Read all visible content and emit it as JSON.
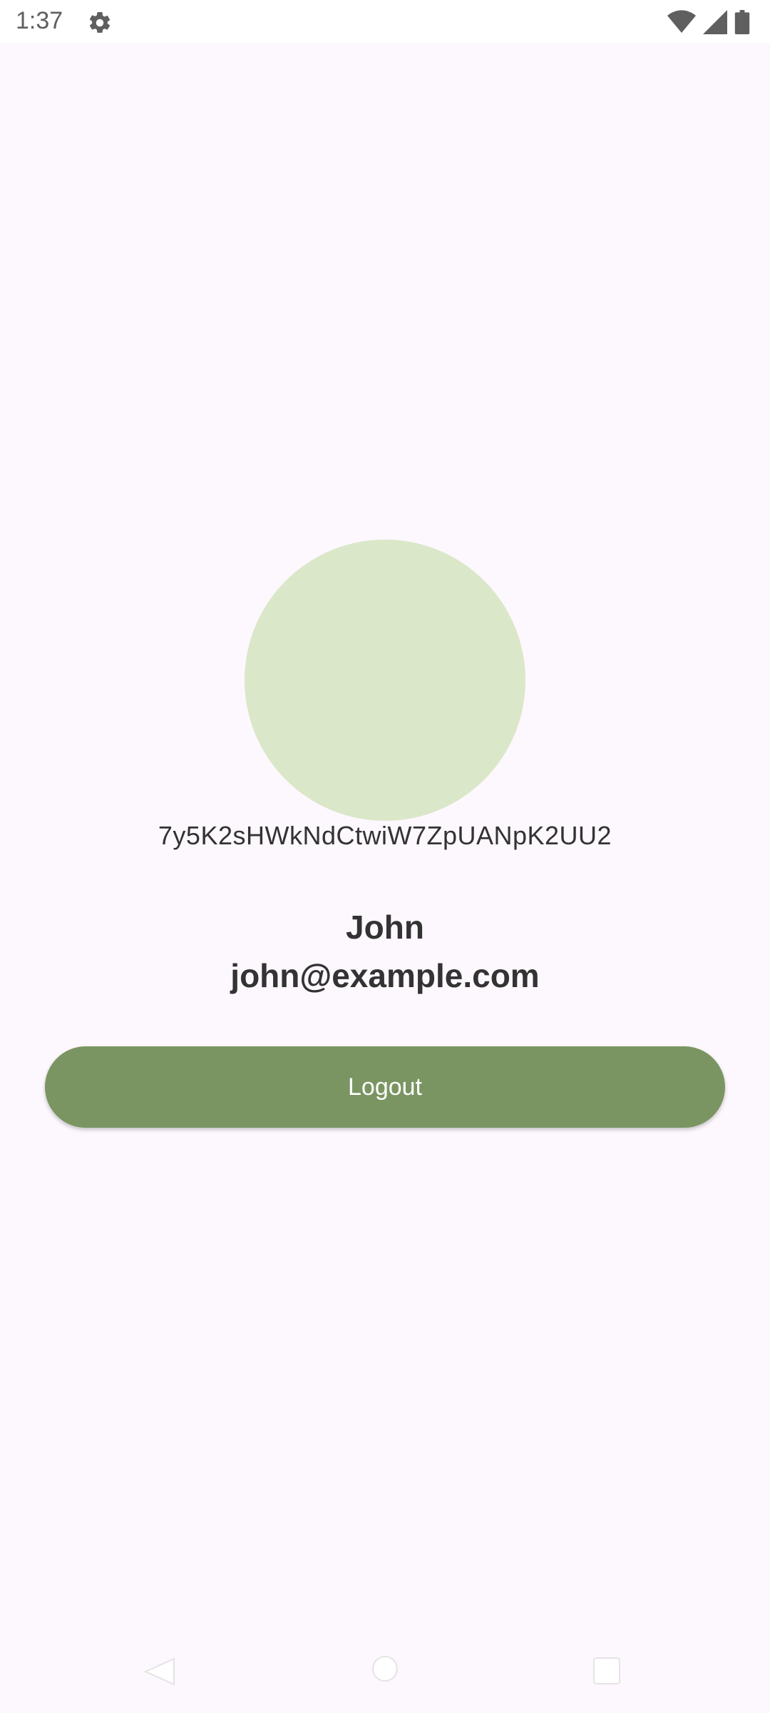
{
  "status_bar": {
    "time": "1:37",
    "icons": [
      "gear-icon",
      "wifi-icon",
      "signal-icon",
      "battery-icon"
    ]
  },
  "profile": {
    "uid": "7y5K2sHWkNdCtwiW7ZpUANpK2UU2",
    "name": "John",
    "email": "john@example.com",
    "avatar_color": "#dae7c9"
  },
  "actions": {
    "logout_label": "Logout",
    "logout_color": "#7a9562"
  },
  "nav": {
    "icons": [
      "back-icon",
      "home-icon",
      "recents-icon"
    ]
  }
}
